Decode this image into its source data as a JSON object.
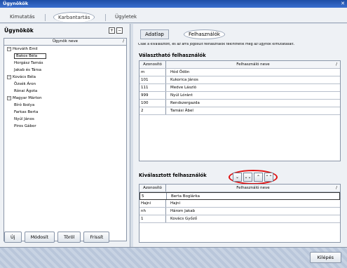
{
  "window": {
    "title": "Ügynökök"
  },
  "main_tabs": [
    {
      "label": "Kimutatás"
    },
    {
      "label": "Karbantartás"
    },
    {
      "label": "Ügyletek"
    }
  ],
  "left": {
    "title": "Ügynökök",
    "column": "Ügynök neve",
    "tree": [
      {
        "label": "Horváth Emil",
        "children": [
          "Bakos Béla",
          "Horgász Tamás",
          "Jakab és Társa"
        ]
      },
      {
        "label": "Kovács Béla",
        "children": [
          "Özsék Áron",
          "Rónai Ágota"
        ]
      },
      {
        "label": "Magyar Márton",
        "children": [
          "Bíró Ibolya",
          "Farkas Berta",
          "Nyúl János",
          "Piros Gábor"
        ]
      }
    ],
    "buttons": {
      "new": "Új",
      "edit": "Módosít",
      "delete": "Töröl",
      "refresh": "Frissít"
    }
  },
  "right": {
    "tabs": [
      {
        "label": "Adatlap"
      },
      {
        "label": "Felhasználók"
      }
    ],
    "info": "Csak a kiválasztott, és az arra jogosult felhasználók tekinthetik meg az ügynök kimutatásait.",
    "available": {
      "title": "Választható felhasználók",
      "headers": [
        "Azonosító",
        "Felhasználó neve"
      ],
      "rows": [
        [
          "m",
          "Hód Ödön"
        ],
        [
          "101",
          "Kukorica János"
        ],
        [
          "111",
          "Medve László"
        ],
        [
          "999",
          "Nyúl Lóránt"
        ],
        [
          "100",
          "Rendszergazda"
        ],
        [
          "2",
          "Tamási Ábel"
        ]
      ]
    },
    "selected": {
      "title": "Kiválasztott felhasználók",
      "headers": [
        "Azonosító",
        "Felhasználó neve"
      ],
      "rows": [
        [
          "5",
          "Berta Boglárka"
        ],
        [
          "Hajni",
          "Hajni"
        ],
        [
          "nh",
          "Három Jakab"
        ],
        [
          "1",
          "Kovács Győző"
        ]
      ]
    },
    "move_buttons": [
      "⌄",
      "⌄⌄",
      "⌃",
      "⌃⌃"
    ]
  },
  "footer": {
    "exit": "Kilépés"
  }
}
